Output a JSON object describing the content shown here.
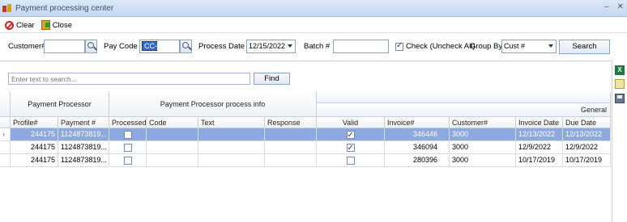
{
  "window": {
    "title": "Payment processing center"
  },
  "toolbar": {
    "clear_label": "Clear",
    "close_label": "Close"
  },
  "filters": {
    "customer_label": "Customer#",
    "customer_value": "",
    "pay_code_label": "Pay Code",
    "pay_code_value": "CC-WEEKLY",
    "process_date_label": "Process Date",
    "process_date_value": "12/15/2022",
    "batch_label": "Batch #",
    "batch_value": "",
    "check_label": "Check (Uncheck All)",
    "check_checked": true,
    "group_by_label": "Group By",
    "group_by_value": "Cust #",
    "search_label": "Search"
  },
  "search": {
    "placeholder": "Enter text to search...",
    "find_label": "Find"
  },
  "grid": {
    "bands": {
      "processor": "Payment Processor",
      "processor_info": "Payment Processor process info",
      "general": "General"
    },
    "columns": [
      "Profile#",
      "Payment #",
      "Processed",
      "Code",
      "Text",
      "Response",
      "Valid",
      "Invoice#",
      "Customer#",
      "Invoice Date",
      "Due Date"
    ],
    "rows": [
      {
        "profile": "244175",
        "payment": "1124873819...",
        "processed": false,
        "code": "",
        "text": "",
        "response": "",
        "valid": true,
        "invoice": "346446",
        "customer": "3000",
        "invoice_date": "12/13/2022",
        "due_date": "12/13/2022",
        "selected": true
      },
      {
        "profile": "244175",
        "payment": "1124873819...",
        "processed": false,
        "code": "",
        "text": "",
        "response": "",
        "valid": true,
        "invoice": "346094",
        "customer": "3000",
        "invoice_date": "12/9/2022",
        "due_date": "12/9/2022",
        "selected": false
      },
      {
        "profile": "244175",
        "payment": "1124873819...",
        "processed": false,
        "code": "",
        "text": "",
        "response": "",
        "valid": false,
        "invoice": "280396",
        "customer": "3000",
        "invoice_date": "10/17/2019",
        "due_date": "10/17/2019",
        "selected": false
      }
    ]
  },
  "side_icons": [
    "excel-export-icon",
    "edit-icon",
    "save-icon"
  ]
}
